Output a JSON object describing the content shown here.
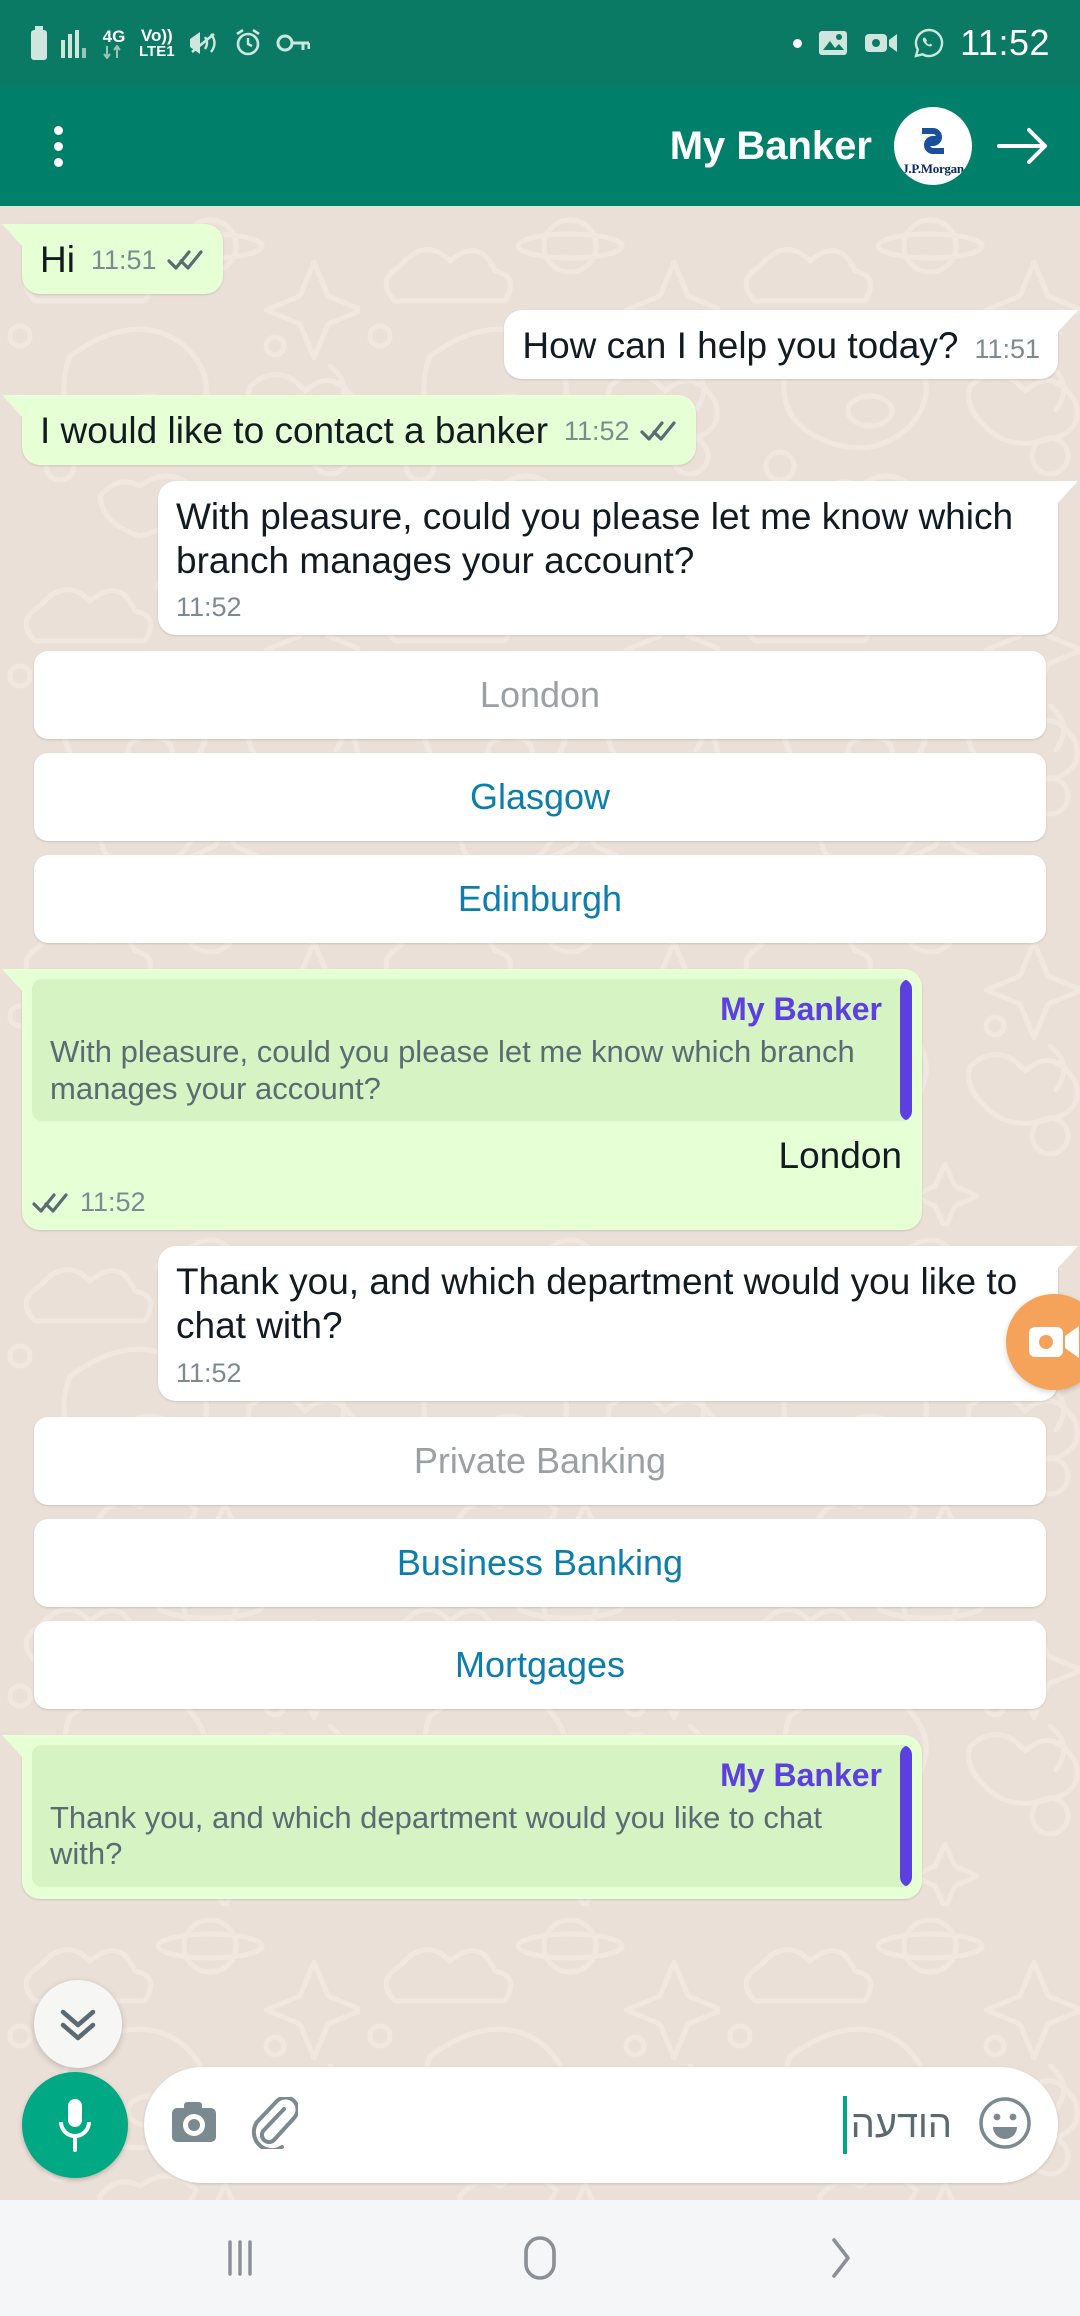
{
  "status_bar": {
    "time": "11:52",
    "network": {
      "gen": "4G",
      "volte": "Vo))",
      "lte": "LTE1"
    },
    "left_icons": [
      "battery-icon",
      "signal-bars-icon",
      "data-transfer-icon",
      "volte-icon",
      "vibrate-icon",
      "alarm-icon",
      "vpn-key-icon"
    ],
    "right_icons": [
      "dot-indicator",
      "photo-icon",
      "video-recorder-icon",
      "whatsapp-icon"
    ]
  },
  "app_bar": {
    "title": "My Banker",
    "avatar_label": "J.P.Morgan",
    "menu_icon": "overflow-menu-icon",
    "back_icon": "back-arrow-icon"
  },
  "colors": {
    "header_green": "#00806a",
    "status_green": "#0a7a64",
    "outgoing_bubble": "#e7ffd4",
    "incoming_bubble": "#ffffff",
    "chat_background": "#ebe0d8",
    "option_blue": "#0c7ead",
    "option_grey": "#9aa0a4",
    "quote_accent_purple": "#5b3fe0",
    "quote_block_green": "#d6f3c3",
    "fab_orange": "#f5a35a",
    "mic_green": "#00a884"
  },
  "messages": [
    {
      "id": "m1",
      "dir": "out",
      "kind": "text",
      "text": "Hi",
      "time": "11:51",
      "status": "read"
    },
    {
      "id": "m2",
      "dir": "in",
      "kind": "text",
      "text": "How can I help you today?",
      "time": "11:51"
    },
    {
      "id": "m3",
      "dir": "out",
      "kind": "text",
      "text": "I would like to contact a banker",
      "time": "11:52",
      "status": "read"
    },
    {
      "id": "m4",
      "dir": "in",
      "kind": "text",
      "text": "With pleasure, could you please let me know which branch manages your account?",
      "time": "11:52"
    },
    {
      "id": "m5",
      "dir": "out",
      "kind": "quoted",
      "quote_name": "My Banker",
      "quote_text": "With pleasure, could you please let me know which branch manages your account?",
      "reply": "London",
      "time": "11:52",
      "status": "read"
    },
    {
      "id": "m6",
      "dir": "in",
      "kind": "text",
      "text": "Thank you, and which department would you like to chat with?",
      "time": "11:52"
    },
    {
      "id": "m7",
      "dir": "out",
      "kind": "quoted",
      "quote_name": "My Banker",
      "quote_text": "Thank you, and which department would you like to chat with?",
      "reply": "",
      "time": "",
      "status": "read"
    }
  ],
  "branch_options": [
    {
      "label": "London",
      "state": "grey"
    },
    {
      "label": "Glasgow",
      "state": "blue"
    },
    {
      "label": "Edinburgh",
      "state": "blue"
    }
  ],
  "department_options": [
    {
      "label": "Private Banking",
      "state": "grey"
    },
    {
      "label": "Business Banking",
      "state": "blue"
    },
    {
      "label": "Mortgages",
      "state": "blue"
    }
  ],
  "floating": {
    "video_button_icon": "video-camera-icon",
    "scroll_down_icon": "double-chevron-down-icon"
  },
  "composer": {
    "placeholder": "הודעה",
    "emoji_icon": "emoji-smiley-icon",
    "attach_icon": "paperclip-icon",
    "camera_icon": "camera-icon",
    "mic_icon": "microphone-icon"
  },
  "nav_bar": {
    "recents_icon": "recents-icon",
    "home_icon": "home-icon",
    "back_icon": "nav-back-chevron-icon"
  }
}
